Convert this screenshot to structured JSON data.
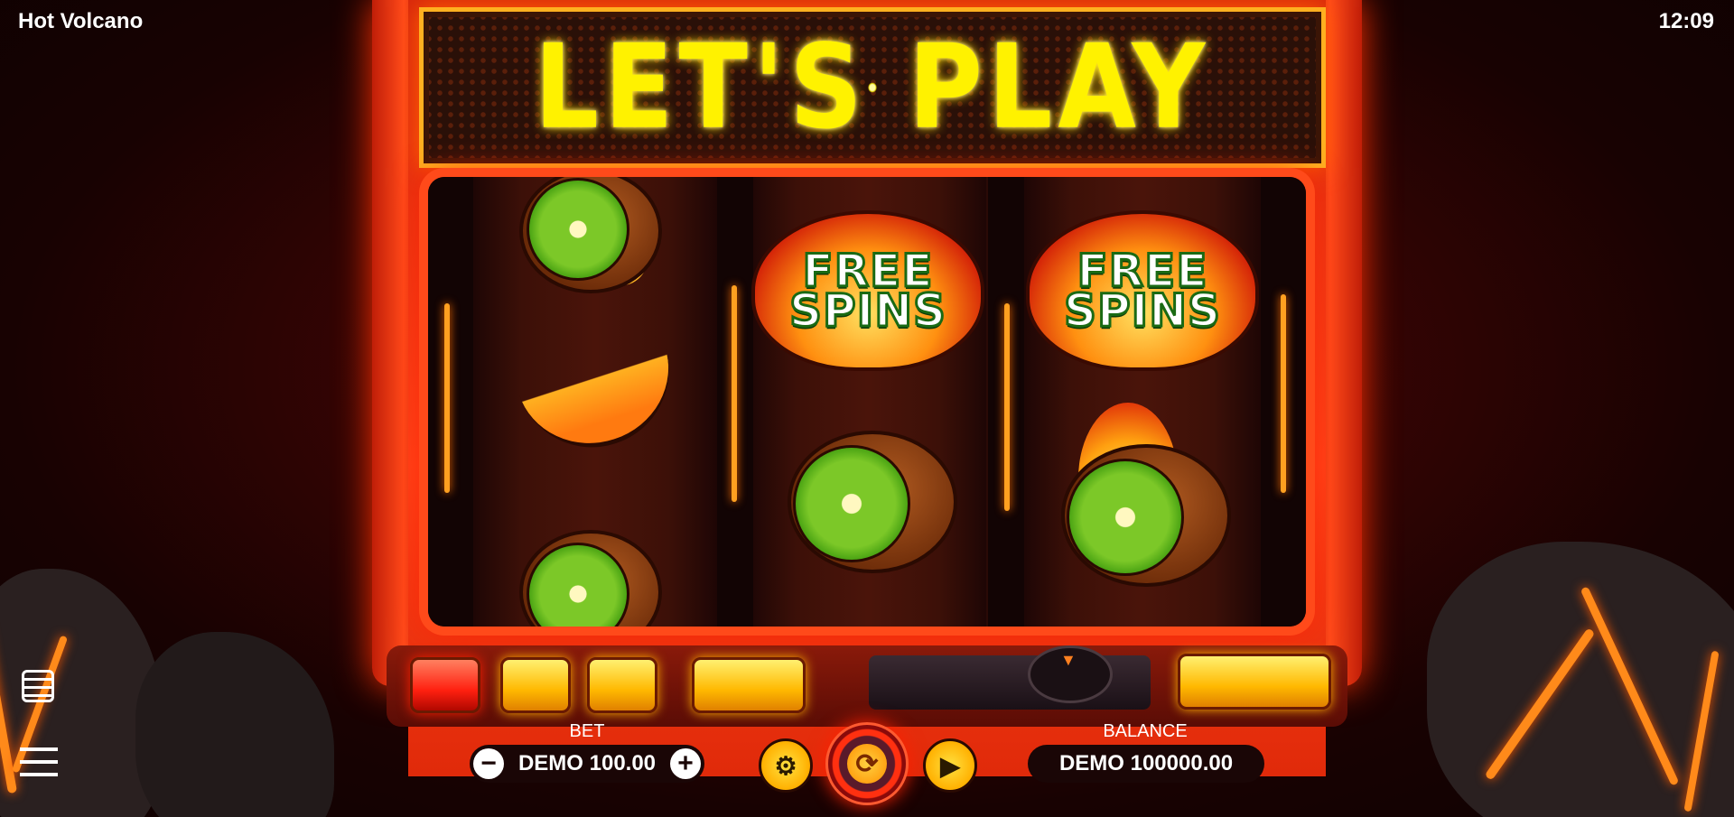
{
  "app": {
    "title": "Hot Volcano",
    "clock": "12:09"
  },
  "marquee": {
    "text": "LET'S PLAY"
  },
  "reels": [
    {
      "symbols": [
        "kiwi-flame",
        "banana",
        "kiwi"
      ]
    },
    {
      "symbols": [
        "free-spins",
        "kiwi"
      ]
    },
    {
      "symbols": [
        "free-spins",
        "kiwi-flame"
      ]
    }
  ],
  "free_spins": {
    "line1": "FREE",
    "line2": "SPINS"
  },
  "hud": {
    "bet_label": "BET",
    "bet_value": "DEMO 100.00",
    "balance_label": "BALANCE",
    "balance_value": "DEMO 100000.00",
    "minus": "−",
    "plus": "+"
  },
  "icons": {
    "paytable": "paytable-icon",
    "menu": "menu-icon",
    "bet_settings": "coins-gear-icon",
    "spin": "spin-arrows-icon",
    "autoplay": "autoplay-icon"
  },
  "colors": {
    "accent": "#ff4218",
    "marquee": "#fff200",
    "gold": "#ffb800"
  }
}
